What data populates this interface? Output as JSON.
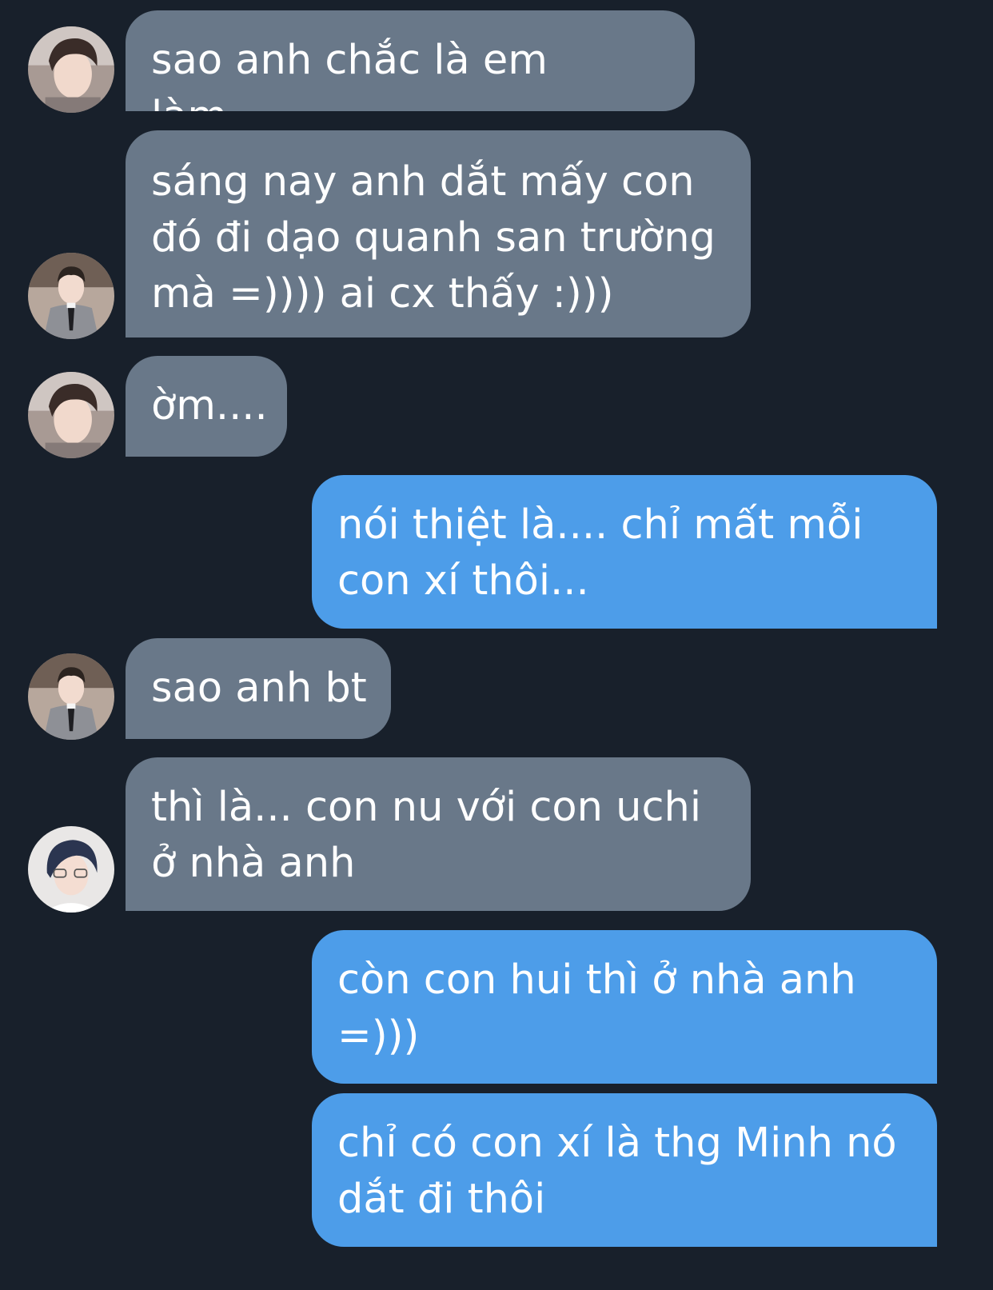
{
  "colors": {
    "background": "#18202b",
    "incoming_bubble": "#697889",
    "outgoing_bubble": "#4d9de9",
    "text": "#ffffff"
  },
  "messages": [
    {
      "direction": "incoming",
      "avatar": "avatar-a-icon",
      "text": "sao anh chắc là em làm..."
    },
    {
      "direction": "incoming",
      "avatar": "avatar-b-icon",
      "text": "sáng nay anh dắt mấy con\nđó đi dạo quanh san trường\nmà =)))) ai cx thấy :)))"
    },
    {
      "direction": "incoming",
      "avatar": "avatar-a-icon",
      "text": "ờm...."
    },
    {
      "direction": "outgoing",
      "text": "nói thiệt là.... chỉ mất mỗi\ncon xí thôi..."
    },
    {
      "direction": "incoming",
      "avatar": "avatar-b-icon",
      "text": "sao anh bt"
    },
    {
      "direction": "incoming",
      "avatar": "avatar-c-icon",
      "text": "thì là... con nu với con uchi\nở nhà anh"
    },
    {
      "direction": "outgoing",
      "text": "còn con hui thì ở nhà anh\n=)))"
    },
    {
      "direction": "outgoing",
      "text": "chỉ có con xí là thg Minh nó\ndắt đi thôi"
    }
  ]
}
